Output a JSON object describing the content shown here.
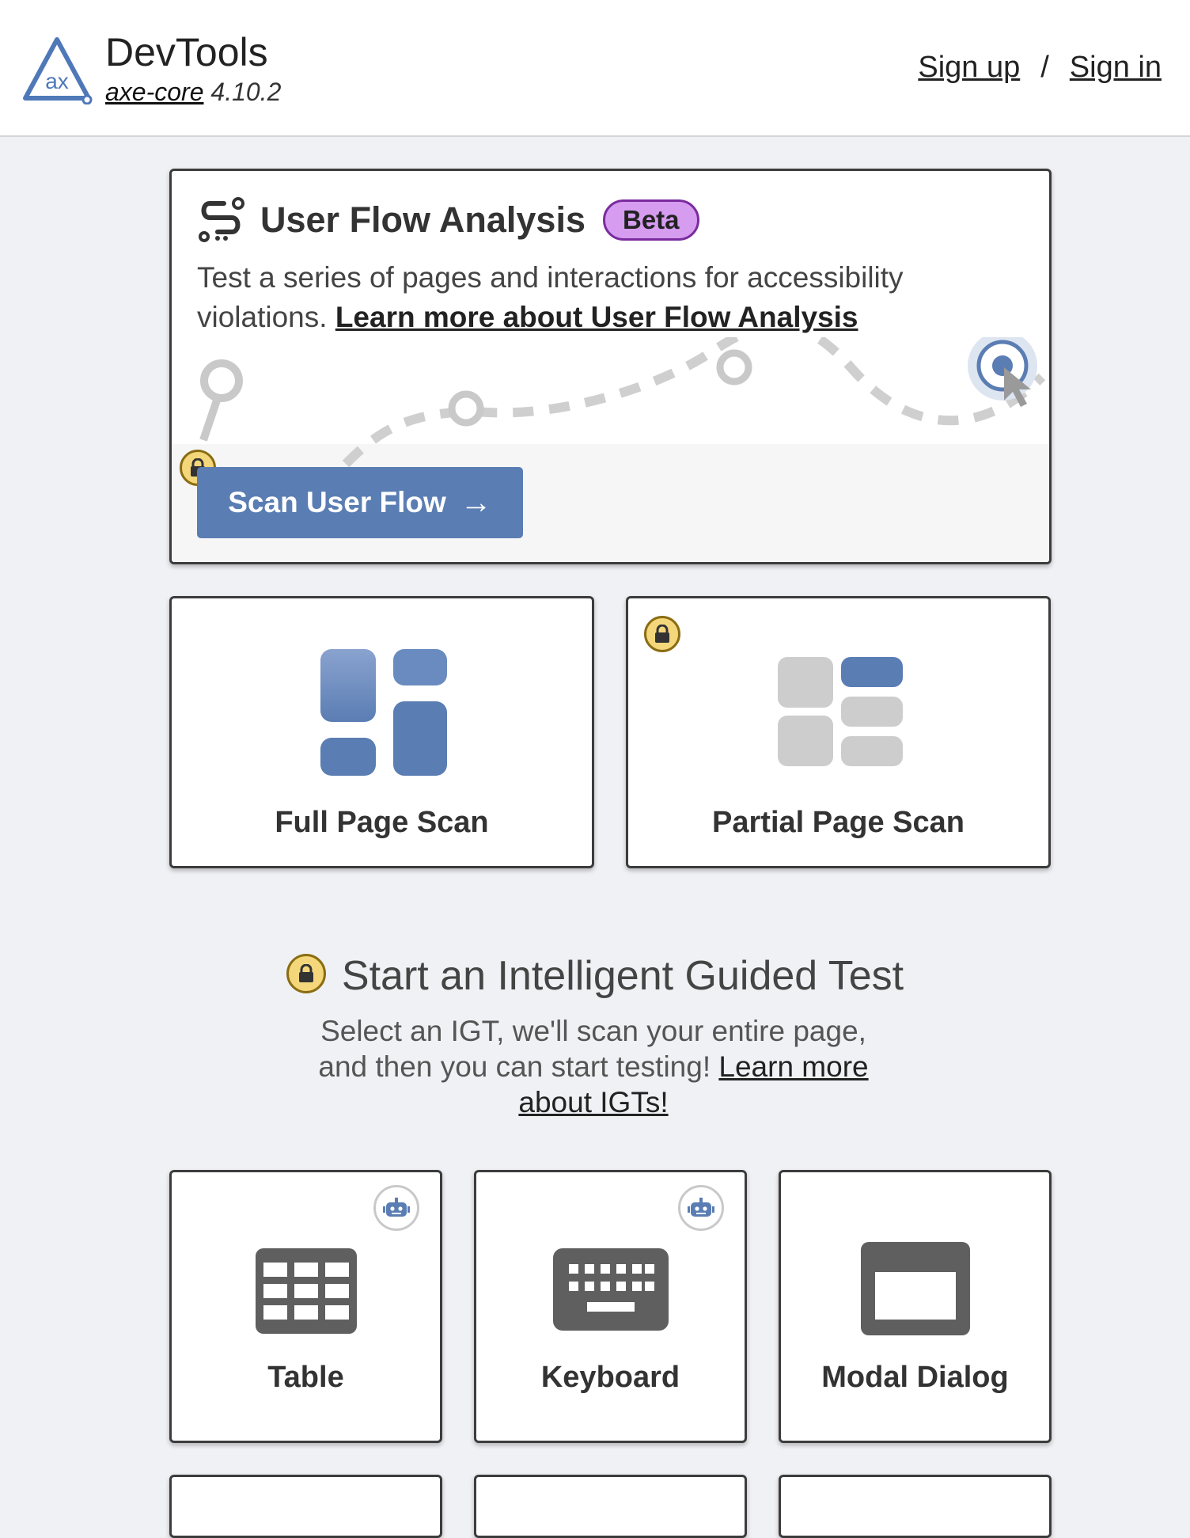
{
  "header": {
    "app_title": "DevTools",
    "engine_link": "axe-core",
    "engine_version": "4.10.2",
    "sign_up": "Sign up",
    "separator": "/",
    "sign_in": "Sign in"
  },
  "user_flow": {
    "title": "User Flow Analysis",
    "badge": "Beta",
    "description": "Test a series of pages and interactions for accessibility violations.",
    "learn_more": "Learn more about User Flow Analysis",
    "button": "Scan User Flow",
    "button_icon": "arrow-right-icon"
  },
  "scans": [
    {
      "label": "Full Page Scan",
      "locked": false
    },
    {
      "label": "Partial Page Scan",
      "locked": true
    }
  ],
  "igt": {
    "heading": "Start an Intelligent Guided Test",
    "description": "Select an IGT, we'll scan your entire page, and then you can start testing!",
    "learn_more": "Learn more about IGTs!",
    "cards": [
      {
        "label": "Table",
        "icon": "table-icon",
        "automated": true
      },
      {
        "label": "Keyboard",
        "icon": "keyboard-icon",
        "automated": true
      },
      {
        "label": "Modal Dialog",
        "icon": "modal-dialog-icon",
        "automated": false
      }
    ]
  },
  "colors": {
    "primary": "#5a7db3",
    "beta_badge": "#d59cf0",
    "lock_badge": "#f5d77b",
    "background": "#f0f1f5"
  }
}
